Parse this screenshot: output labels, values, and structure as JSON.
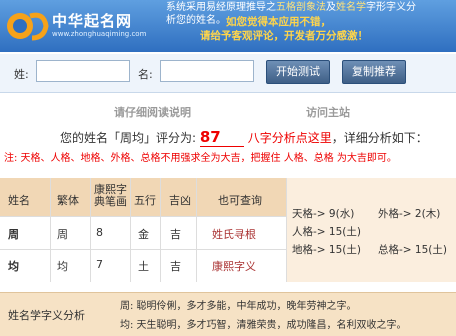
{
  "header": {
    "logo_text": "中华起名网",
    "logo_url": "www.zhonghuaqiming.com",
    "line1_pre": "系统采用易经原理推导之",
    "line1_hl1": "五格剖象法",
    "line1_mid": "及",
    "line1_hl2": "姓名学",
    "line1_post": "字形字义分",
    "line2": "析您的姓名。",
    "line3": "如您觉得本应用不错，",
    "line4": "请给予客观评论，开发者万分感激！"
  },
  "form": {
    "surname_label": "姓:",
    "name_label": "名:",
    "test_button": "开始测试",
    "copy_button": "复制推荐"
  },
  "links": {
    "read_instructions": "请仔细阅读说明",
    "visit_main": "访问主站"
  },
  "score": {
    "prefix": "您的姓名「周均」评分为:",
    "value": "87",
    "suffix_link": "八字分析点这里",
    "suffix": "，详细分析如下："
  },
  "note": "注: 天格、人格、地格、外格、总格不用强求全为大吉，把握住 人格、总格 为大吉即可。",
  "table": {
    "headers": [
      "姓名",
      "繁体",
      "康熙字典笔画",
      "五行",
      "吉凶",
      "也可查询"
    ],
    "rows": [
      {
        "name": "周",
        "trad": "周",
        "strokes": "8",
        "element": "金",
        "luck": "吉",
        "query": "姓氏寻根"
      },
      {
        "name": "均",
        "trad": "均",
        "strokes": "7",
        "element": "土",
        "luck": "吉",
        "query": "康熙字义"
      }
    ],
    "grids": {
      "tian": "天格-> 9(水)",
      "ren": "人格-> 15(土)",
      "di": "地格-> 15(土)",
      "wai": "外格-> 2(木)",
      "zong": "总格-> 15(土)"
    }
  },
  "analysis": {
    "title": "姓名学字义分析",
    "line1": "周: 聪明伶俐，多才多能，中年成功，晚年劳神之字。",
    "line2": "均: 天生聪明，多才巧智，清雅荣贵，成功隆昌，名利双收之字。"
  }
}
